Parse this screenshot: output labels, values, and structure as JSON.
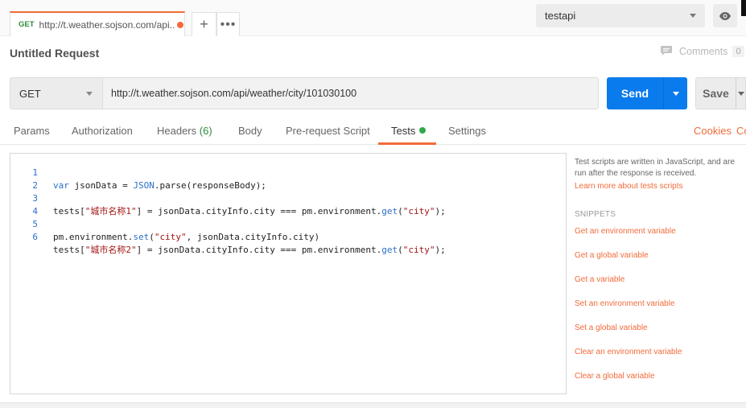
{
  "tab": {
    "method": "GET",
    "url": "http://t.weather.sojson.com/api..."
  },
  "environment": {
    "selected": "testapi"
  },
  "title": "Untitled Request",
  "comments": {
    "label": "Comments",
    "count": "0"
  },
  "request": {
    "method": "GET",
    "url": "http://t.weather.sojson.com/api/weather/city/101030100"
  },
  "buttons": {
    "send": "Send",
    "save": "Save"
  },
  "subtabs": {
    "params": "Params",
    "authorization": "Authorization",
    "headers": "Headers",
    "headers_count": "(6)",
    "body": "Body",
    "prerequest": "Pre-request Script",
    "tests": "Tests",
    "settings": "Settings",
    "cookies": "Cookies",
    "code": "Code"
  },
  "editor": {
    "line_numbers": [
      "1",
      "2",
      "3",
      "4",
      "5",
      "6"
    ],
    "lines": [
      {
        "pre": "",
        "kw": "var",
        "rest": " jsonData = ",
        "fn": "JSON",
        "rest2": ".parse(responseBody);"
      },
      {
        "text": ""
      },
      {
        "a": "tests[",
        "s1": "\"城市名称1\"",
        "b": "] = jsonData.cityInfo.city === pm.environment.",
        "fn": "get",
        "c": "(",
        "s2": "\"city\"",
        "d": ");"
      },
      {
        "text": ""
      },
      {
        "a": "pm.environment.",
        "fn": "set",
        "b": "(",
        "s1": "\"city\"",
        "c": ", jsonData.cityInfo.city)"
      },
      {
        "a": "tests[",
        "s1": "\"城市名称2\"",
        "b": "] = jsonData.cityInfo.city === pm.environment.",
        "fn": "get",
        "c": "(",
        "s2": "\"city\"",
        "d": ");"
      }
    ]
  },
  "sidebar": {
    "description": "Test scripts are written in JavaScript, and are run after the response is received.",
    "learn_link": "Learn more about tests scripts",
    "snippets_heading": "SNIPPETS",
    "snippets": [
      "Get an environment variable",
      "Get a global variable",
      "Get a variable",
      "Set an environment variable",
      "Set a global variable",
      "Clear an environment variable",
      "Clear a global variable"
    ]
  },
  "colors": {
    "accent": "#f26b3a",
    "send": "#097bed",
    "get_method": "#2e8b3e",
    "tests_dot": "#2eaa4c"
  },
  "icons": {
    "add_tab": "plus-icon",
    "more_tabs": "ellipsis-icon",
    "env_preview": "eye-icon",
    "comments": "comment-icon"
  }
}
